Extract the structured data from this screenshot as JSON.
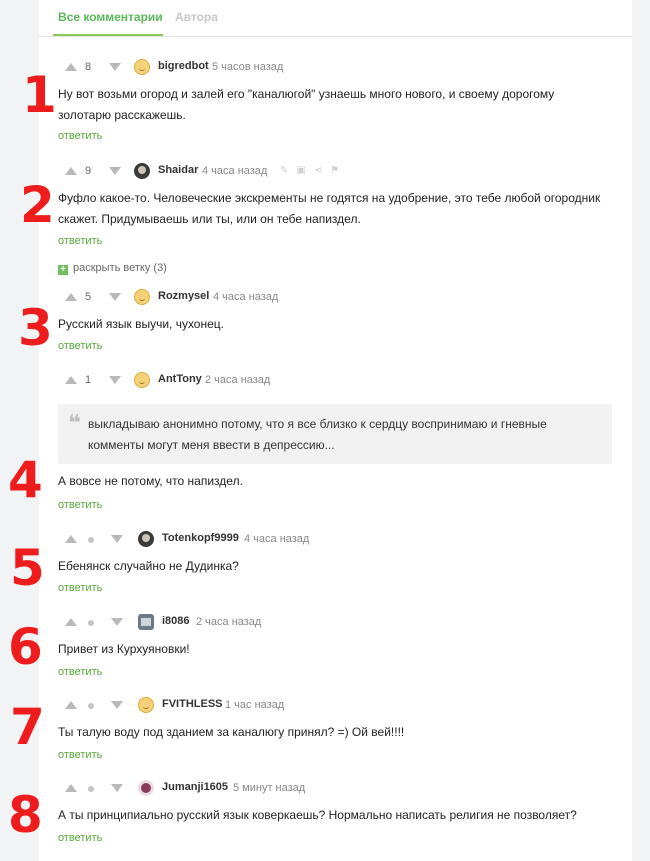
{
  "tabs": {
    "all": "Все комментарии",
    "author": "Автора"
  },
  "actions": {
    "reply": "ответить",
    "expand": "раскрыть ветку (3)"
  },
  "comments": [
    {
      "score": "8",
      "author": "bigredbot",
      "time": "5 часов назад",
      "text": "Ну вот возьми огород и залей его \"каналюгой\" узнаешь много нового, и своему дорогому золотарю расскажешь.",
      "annotation": "1"
    },
    {
      "score": "9",
      "author": "Shaidar",
      "time": "4 часа назад",
      "text": "Фуфло какое-то. Человеческие экскременты не годятся на удобрение, это тебе любой огородник скажет. Придумываешь или ты, или он тебе напиздел.",
      "annotation": "2"
    },
    {
      "score": "5",
      "author": "Rozmysel",
      "time": "4 часа назад",
      "text": "Русский язык выучи, чухонец.",
      "annotation": "3"
    },
    {
      "score": "1",
      "author": "AntTony",
      "time": "2 часа назад",
      "quote": "выкладываю анонимно потому, что я все близко к сердцу воспринимаю и гневные комменты могут меня ввести в депрессию...",
      "text": "А вовсе не потому, что напиздел.",
      "annotation": "4"
    },
    {
      "author": "Totenkopf9999",
      "time": "4 часа назад",
      "text": "Ебенянск случайно не Дудинка?",
      "annotation": "5"
    },
    {
      "author": "i8086",
      "time": "2 часа назад",
      "text": "Привет из Курхуяновки!",
      "annotation": "6"
    },
    {
      "author": "FVITHLESS",
      "time": "1 час назад",
      "text": "Ты талую воду под зданием за каналюгу принял? =) Ой вей!!!!",
      "annotation": "7"
    },
    {
      "author": "Jumanji1605",
      "time": "5 минут назад",
      "text": "А ты принципиально русский язык коверкаешь? Нормально написать религия не позволяет?",
      "annotation": "8"
    }
  ]
}
